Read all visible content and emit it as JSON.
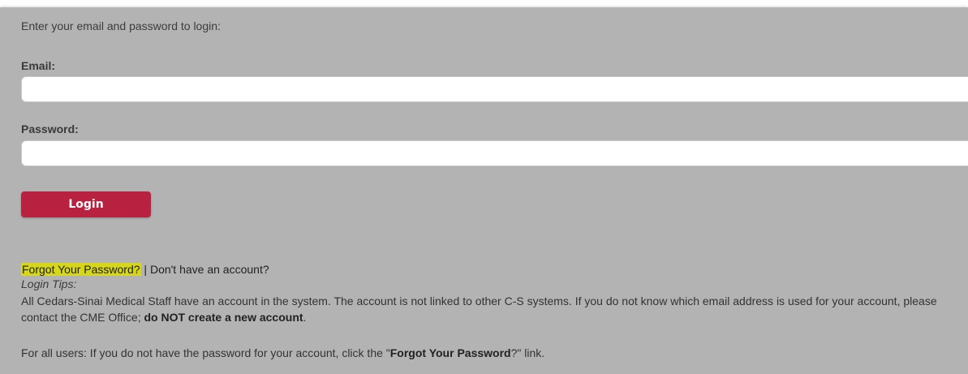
{
  "intro_text": "Enter your email and password to login:",
  "email": {
    "label": "Email:",
    "value": "",
    "placeholder": ""
  },
  "password": {
    "label": "Password:",
    "value": "",
    "placeholder": ""
  },
  "login_button": "Login",
  "links": {
    "forgot_password": "Forgot Your Password?",
    "separator": " | ",
    "no_account": "Don't have an account?"
  },
  "tips": {
    "title": "Login Tips:",
    "body_part1": "All Cedars-Sinai Medical Staff have an account in the system. The account is not linked to other C-S systems. If you do not know which email address is used for your account, please contact the CME Office; ",
    "body_bold": "do NOT create a new account",
    "body_end": ".",
    "footer_part1": "For all users: If you do not have the password for your account, click the \"",
    "footer_bold": "Forgot Your Password",
    "footer_end": "?\" link."
  },
  "colors": {
    "panel_background": "#b3b3b3",
    "login_button": "#b8213f",
    "highlight": "#d6d61a"
  }
}
